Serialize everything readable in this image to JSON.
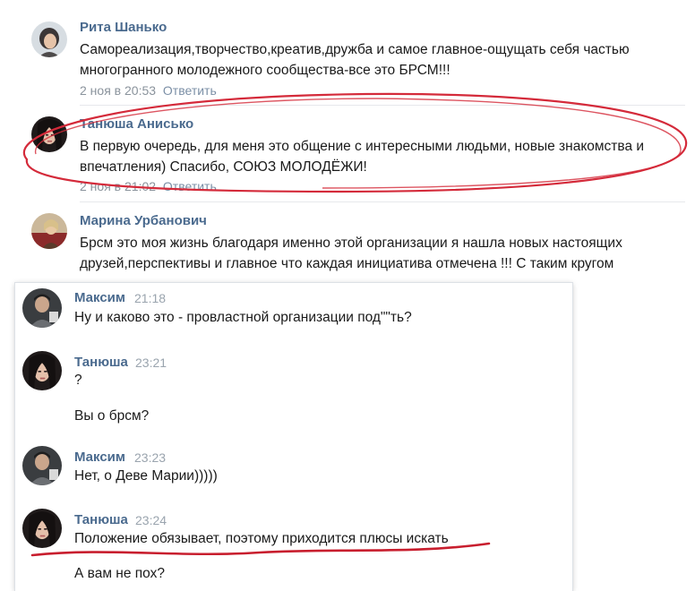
{
  "comments": [
    {
      "author": "Рита Шанько",
      "text": "Самореализация,творчество,креатив,дружба и самое главное-ощущать себя частью многогранного молодежного сообщества-все это БРСМ!!!",
      "date": "2 ноя в 20:53",
      "reply": "Ответить",
      "avatar_icon": "woman-short-hair-photo"
    },
    {
      "author": "Танюша Анисько",
      "text": "В первую очередь, для меня это общение с интересными людьми, новые знакомства и впечатления) Спасибо, СОЮЗ МОЛОДЁЖИ!",
      "date": "2 ноя в 21:02",
      "reply": "Ответить",
      "avatar_icon": "woman-dark-hair-photo"
    },
    {
      "author": "Марина Урбанович",
      "text": "Брсм это моя жизнь благодаря именно этой организации я нашла новых настоящих друзей,перспективы и главное что каждая инициатива отмечена !!! С таким кругом",
      "avatar_icon": "woman-blonde-photo"
    }
  ],
  "chat": [
    {
      "author": "Максим",
      "time": "21:18",
      "lines": [
        "Ну и каково это - провластной организации под\"\"ть?"
      ],
      "avatar_icon": "man-photo"
    },
    {
      "author": "Танюша",
      "time": "23:21",
      "lines": [
        "?",
        "Вы о брсм?"
      ],
      "avatar_icon": "woman-dark-hair-photo"
    },
    {
      "author": "Максим",
      "time": "23:23",
      "lines": [
        "Нет, о Деве Марии)))))"
      ],
      "avatar_icon": "man-photo"
    },
    {
      "author": "Танюша",
      "time": "23:24",
      "lines": [
        "Положение обязывает, поэтому приходится плюсы искать",
        "А вам не пох?"
      ],
      "avatar_icon": "woman-dark-hair-photo"
    }
  ],
  "colors": {
    "author": "#4a6a8e",
    "meta": "#8a939c",
    "annotation": "#d42a3a"
  }
}
